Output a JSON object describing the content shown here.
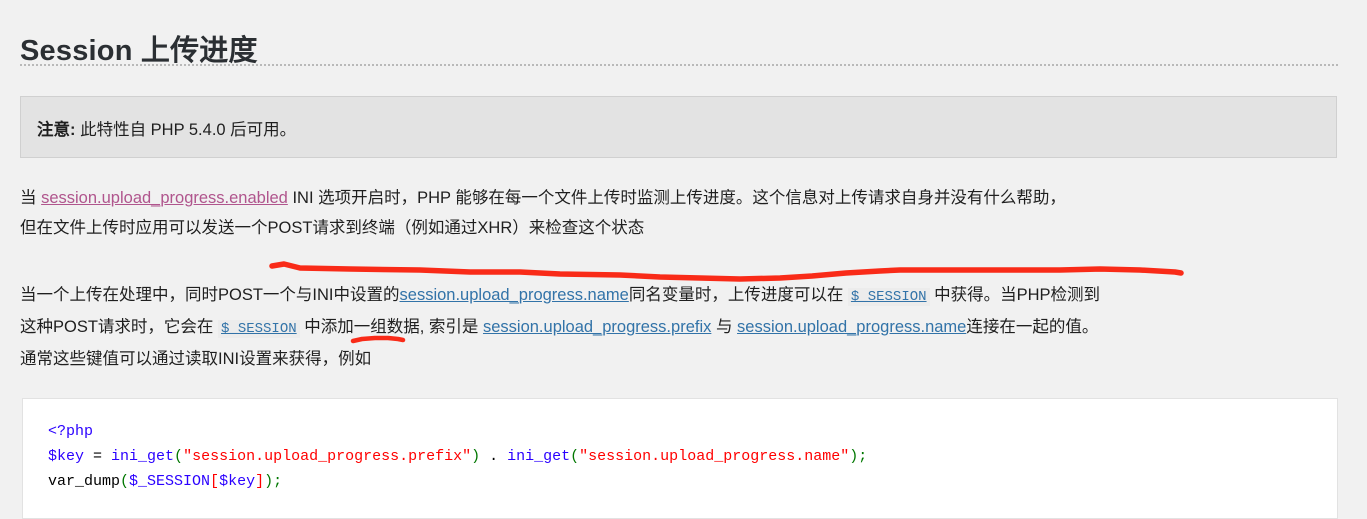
{
  "title": "Session 上传进度",
  "notice": {
    "label": "注意:",
    "text": " 此特性自 PHP 5.4.0 后可用。"
  },
  "paragraph1": {
    "l1_a": "当 ",
    "l1_link": "session.upload_progress.enabled",
    "l1_b": " INI 选项开启时，PHP 能够在每一个文件上传时监测上传进度。这个信息对上传请求自身并没有什么帮助，",
    "l2": "但在文件上传时应用可以发送一个POST请求到终端（例如通过XHR）来检查这个状态"
  },
  "paragraph2": {
    "l1_a": "当一个上传在处理中，同时POST一个与INI中设置的",
    "l1_link1": "session.upload_progress.name",
    "l1_b": "同名变量时，上传进度可以在 ",
    "l1_code": "$_SESSION",
    "l1_c": " 中获得。当PHP检测到",
    "l2_a": "这种POST请求时，它会在 ",
    "l2_code": "$_SESSION",
    "l2_b": " 中添加一组数据, 索引是 ",
    "l2_link1": "session.upload_progress.prefix",
    "l2_c": " 与 ",
    "l2_link2": "session.upload_progress.name",
    "l2_d": "连接在一起的值。",
    "l3": "通常这些键值可以通过读取INI设置来获得，例如"
  },
  "code": {
    "line1_tag": "<?php",
    "line2_var": "$key",
    "line2_eq": " = ",
    "line2_fn1": "ini_get",
    "line2_open1": "(",
    "line2_str1": "\"session.upload_progress.prefix\"",
    "line2_close1": ")",
    "line2_concat": " . ",
    "line2_fn2": "ini_get",
    "line2_open2": "(",
    "line2_str2": "\"session.upload_progress.name\"",
    "line2_close2": ")",
    "line2_semi": ";",
    "line3_fn": "var_dump",
    "line3_open": "(",
    "line3_var": "$_SESSION",
    "line3_br_open": "[",
    "line3_key": "$key",
    "line3_br_close": "]",
    "line3_close": ")",
    "line3_semi": ";"
  },
  "annotations": {
    "color": "#f92b18",
    "mark1_name": "long-underline-stroke",
    "mark2_name": "short-underline-stroke"
  }
}
